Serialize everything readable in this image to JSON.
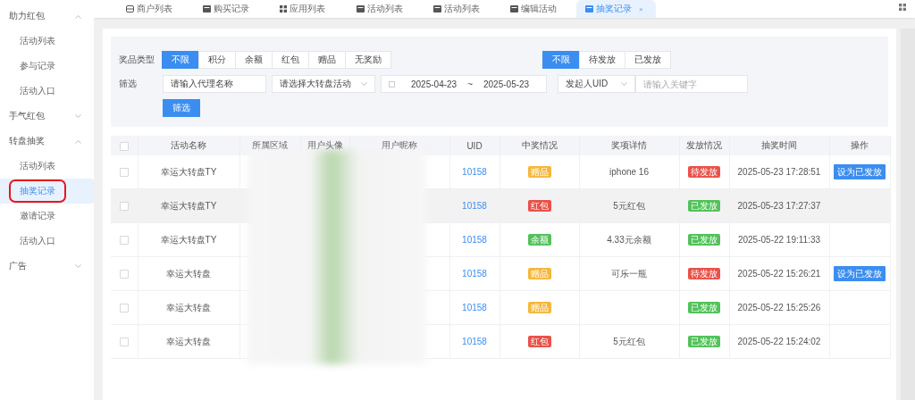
{
  "sidebar": {
    "groups": [
      {
        "label": "助力红包",
        "expanded": true,
        "items": [
          {
            "label": "活动列表",
            "selected": false,
            "circled": false
          },
          {
            "label": "参与记录",
            "selected": false,
            "circled": false
          },
          {
            "label": "活动入口",
            "selected": false,
            "circled": false
          }
        ]
      },
      {
        "label": "手气红包",
        "expanded": false
      },
      {
        "label": "转盘抽奖",
        "expanded": true,
        "items": [
          {
            "label": "活动列表",
            "selected": false,
            "circled": false
          },
          {
            "label": "抽奖记录",
            "selected": true,
            "circled": true
          },
          {
            "label": "邀请记录",
            "selected": false,
            "circled": false
          },
          {
            "label": "活动入口",
            "selected": false,
            "circled": false
          }
        ]
      },
      {
        "label": "广告",
        "expanded": false
      }
    ]
  },
  "tabs": [
    {
      "label": "商户列表",
      "selected": false,
      "closable": false
    },
    {
      "label": "购买记录",
      "selected": false,
      "closable": false
    },
    {
      "label": "应用列表",
      "selected": false,
      "closable": false
    },
    {
      "label": "活动列表",
      "selected": false,
      "closable": false
    },
    {
      "label": "活动列表",
      "selected": false,
      "closable": false
    },
    {
      "label": "编辑活动",
      "selected": false,
      "closable": false
    },
    {
      "label": "抽奖记录",
      "selected": true,
      "closable": true,
      "close": "×"
    }
  ],
  "filters": {
    "prize_type_label": "奖品类型",
    "prize_types": [
      {
        "label": "不限",
        "selected": true
      },
      {
        "label": "积分",
        "selected": false
      },
      {
        "label": "余额",
        "selected": false
      },
      {
        "label": "红包",
        "selected": false
      },
      {
        "label": "赠品",
        "selected": false
      },
      {
        "label": "无奖励",
        "selected": false
      }
    ],
    "statuses": [
      {
        "label": "不限",
        "selected": true
      },
      {
        "label": "待发放",
        "selected": false
      },
      {
        "label": "已发放",
        "selected": false
      }
    ],
    "filter_label": "筛选",
    "agent_name": {
      "value": "请输入代理名称"
    },
    "activity_select": {
      "value": "请选择大转盘活动"
    },
    "date_from": "2025-04-23",
    "date_sep": "~",
    "date_to": "2025-05-23",
    "uid_select": {
      "value": "发起人UID"
    },
    "keyword": {
      "placeholder": "请输入关键字"
    },
    "submit": "筛选"
  },
  "table": {
    "select_all_checked": false,
    "columns": [
      "活动名称",
      "所属区域",
      "用户头像",
      "用户昵称",
      "UID",
      "中奖情况",
      "奖项详情",
      "发放情况",
      "抽奖时间",
      "操作"
    ],
    "rows": [
      {
        "checked": false,
        "highlighted": false,
        "name": "幸运大转盘TY",
        "uid": "10158",
        "prize": {
          "text": "赠品",
          "color": "#f5b73b"
        },
        "detail": "iphone 16",
        "status": {
          "text": "待发放",
          "color": "#e9524a"
        },
        "time": "2025-05-23 17:28:51",
        "action": "设为已发放"
      },
      {
        "checked": false,
        "highlighted": true,
        "name": "幸运大转盘TY",
        "uid": "10158",
        "prize": {
          "text": "红包",
          "color": "#e9524a"
        },
        "detail": "5元红包",
        "status": {
          "text": "已发放",
          "color": "#52c25a"
        },
        "time": "2025-05-23 17:27:37"
      },
      {
        "checked": false,
        "highlighted": false,
        "name": "幸运大转盘TY",
        "uid": "10158",
        "prize": {
          "text": "余额",
          "color": "#52c25a"
        },
        "detail": "4.33元余额",
        "status": {
          "text": "已发放",
          "color": "#52c25a"
        },
        "time": "2025-05-22 19:11:33"
      },
      {
        "checked": false,
        "highlighted": false,
        "name": "幸运大转盘",
        "uid": "10158",
        "prize": {
          "text": "赠品",
          "color": "#f5b73b"
        },
        "detail": "可乐一瓶",
        "status": {
          "text": "待发放",
          "color": "#e9524a"
        },
        "time": "2025-05-22 15:26:21",
        "action": "设为已发放"
      },
      {
        "checked": false,
        "highlighted": false,
        "name": "幸运大转盘",
        "uid": "10158",
        "prize": {
          "text": "赠品",
          "color": "#f5b73b"
        },
        "status": {
          "text": "已发放",
          "color": "#52c25a"
        },
        "time": "2025-05-22 15:25:26"
      },
      {
        "checked": false,
        "highlighted": false,
        "name": "幸运大转盘",
        "uid": "10158",
        "prize": {
          "text": "红包",
          "color": "#e9524a"
        },
        "detail": "5元红包",
        "status": {
          "text": "已发放",
          "color": "#52c25a"
        },
        "time": "2025-05-22 15:24:02"
      }
    ]
  }
}
